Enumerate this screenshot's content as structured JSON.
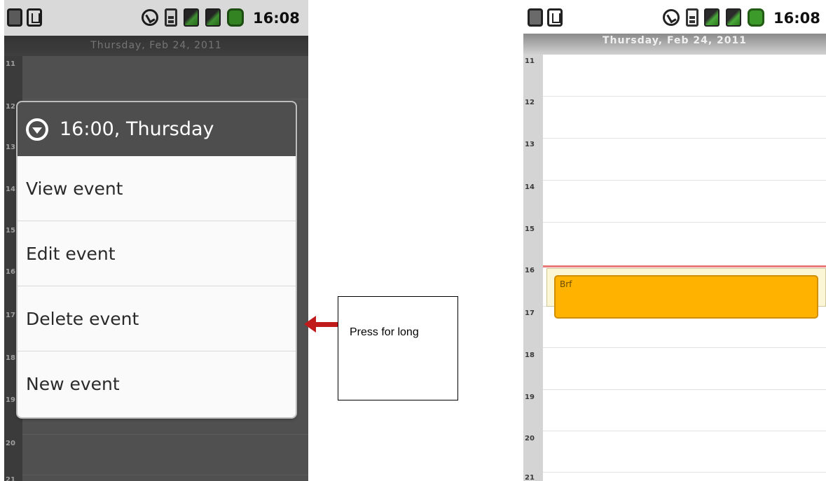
{
  "left": {
    "status_time": "16:08",
    "date_header": "Thursday, Feb 24, 2011",
    "hours": [
      "11",
      "12",
      "13",
      "14",
      "15",
      "16",
      "17",
      "18",
      "19",
      "20",
      "21"
    ],
    "menu": {
      "title": "16:00, Thursday",
      "items": [
        "View event",
        "Edit event",
        "Delete event",
        "New event"
      ]
    }
  },
  "annotation": {
    "callout_text": "Press for long",
    "arrow_color": "#c11a1a"
  },
  "right": {
    "status_time": "16:08",
    "date_header": "Thursday, Feb 24, 2011",
    "hours": [
      "11",
      "12",
      "13",
      "14",
      "15",
      "16",
      "17",
      "18",
      "19",
      "20",
      "21"
    ],
    "event": {
      "title": "Brf",
      "color": "#ffb300"
    }
  }
}
